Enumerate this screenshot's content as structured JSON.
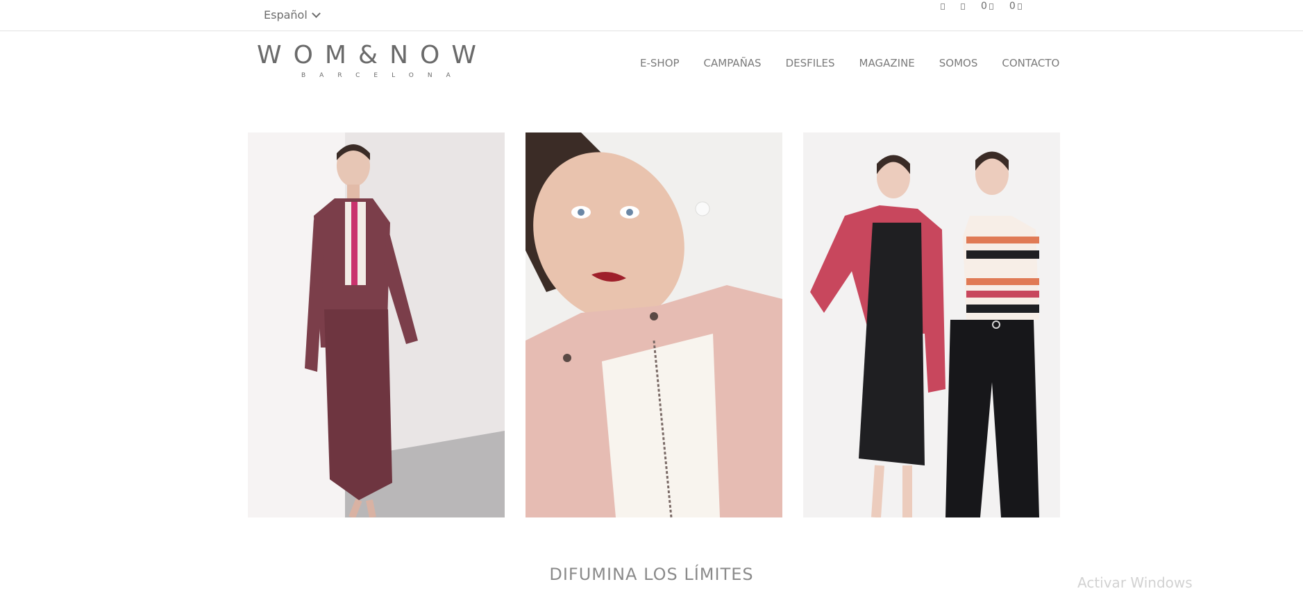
{
  "topbar": {
    "language": "Español",
    "icons": [
      {
        "name": "user-icon"
      },
      {
        "name": "heart-icon"
      },
      {
        "name": "wishlist-count-icon",
        "count": "0"
      },
      {
        "name": "cart-icon",
        "count": "0"
      }
    ]
  },
  "header": {
    "logo_main": "WOM&NOW",
    "logo_sub": "BARCELONA",
    "nav": [
      "E-SHOP",
      "CAMPAÑAS",
      "DESFILES",
      "MAGAZINE",
      "SOMOS",
      "CONTACTO"
    ]
  },
  "main": {
    "headline": "DIFUMINA LOS LÍMITES"
  },
  "overlay": {
    "watermark": "Activar Windows"
  }
}
